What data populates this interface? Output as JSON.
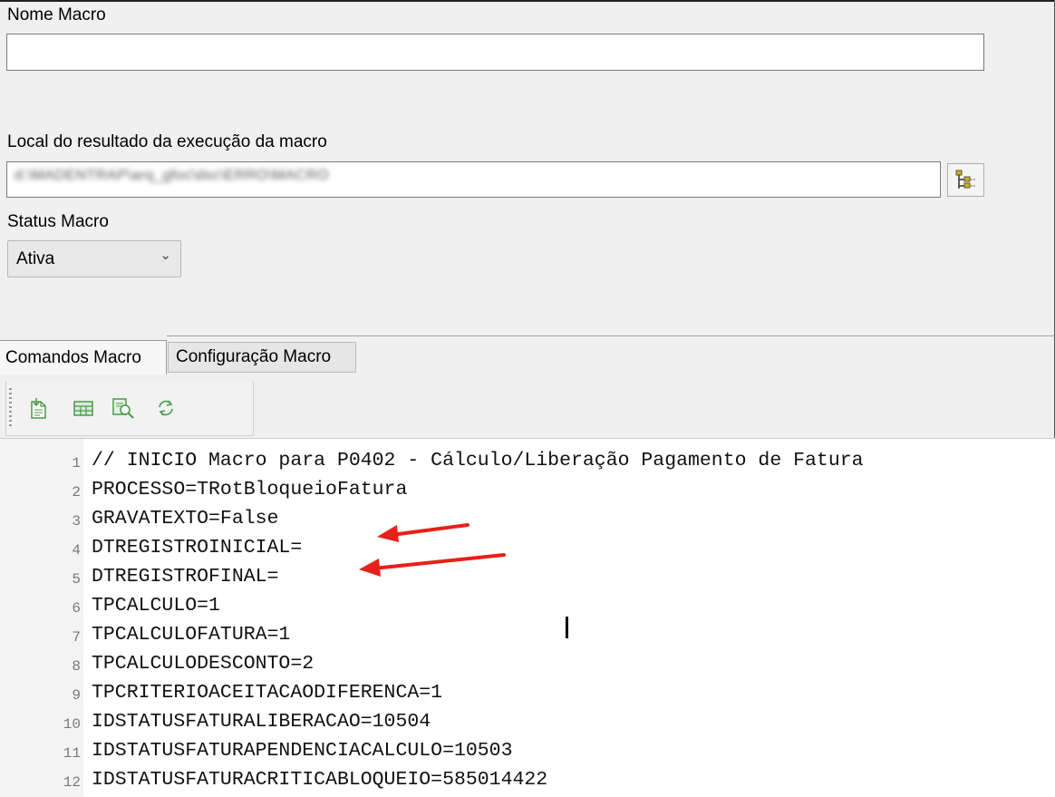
{
  "form": {
    "macro_name_label": "Nome Macro",
    "macro_name_value": "",
    "result_location_label": "Local do resultado da execução da macro",
    "result_location_value": "d:\\MADENTRAP\\arq_gfoc\\dsc\\ERRO\\MACRO",
    "status_label": "Status Macro",
    "status_value": "Ativa"
  },
  "tabs": [
    {
      "label": "Comandos Macro",
      "active": true
    },
    {
      "label": "Configuração Macro",
      "active": false
    }
  ],
  "toolbar": {
    "icons": [
      "import-file-icon",
      "grid-icon",
      "find-icon",
      "refresh-icon"
    ]
  },
  "editor": {
    "lines": [
      {
        "num": "1",
        "text": "// INICIO Macro para P0402 - Cálculo/Liberação Pagamento de Fatura"
      },
      {
        "num": "2",
        "text": "PROCESSO=TRotBloqueioFatura"
      },
      {
        "num": "3",
        "text": "GRAVATEXTO=False"
      },
      {
        "num": "4",
        "text": "DTREGISTROINICIAL="
      },
      {
        "num": "5",
        "text": "DTREGISTROFINAL="
      },
      {
        "num": "6",
        "text": "TPCALCULO=1"
      },
      {
        "num": "7",
        "text": "TPCALCULOFATURA=1"
      },
      {
        "num": "8",
        "text": "TPCALCULODESCONTO=2"
      },
      {
        "num": "9",
        "text": "TPCRITERIOACEITACAODIFERENCA=1"
      },
      {
        "num": "10",
        "text": "IDSTATUSFATURALIBERACAO=10504"
      },
      {
        "num": "11",
        "text": "IDSTATUSFATURAPENDENCIACALCULO=10503"
      },
      {
        "num": "12",
        "text": "IDSTATUSFATURACRITICABLOQUEIO=585014422"
      }
    ]
  },
  "colors": {
    "annotation_arrow": "#e8201a",
    "window_background": "#f0f0f0"
  }
}
